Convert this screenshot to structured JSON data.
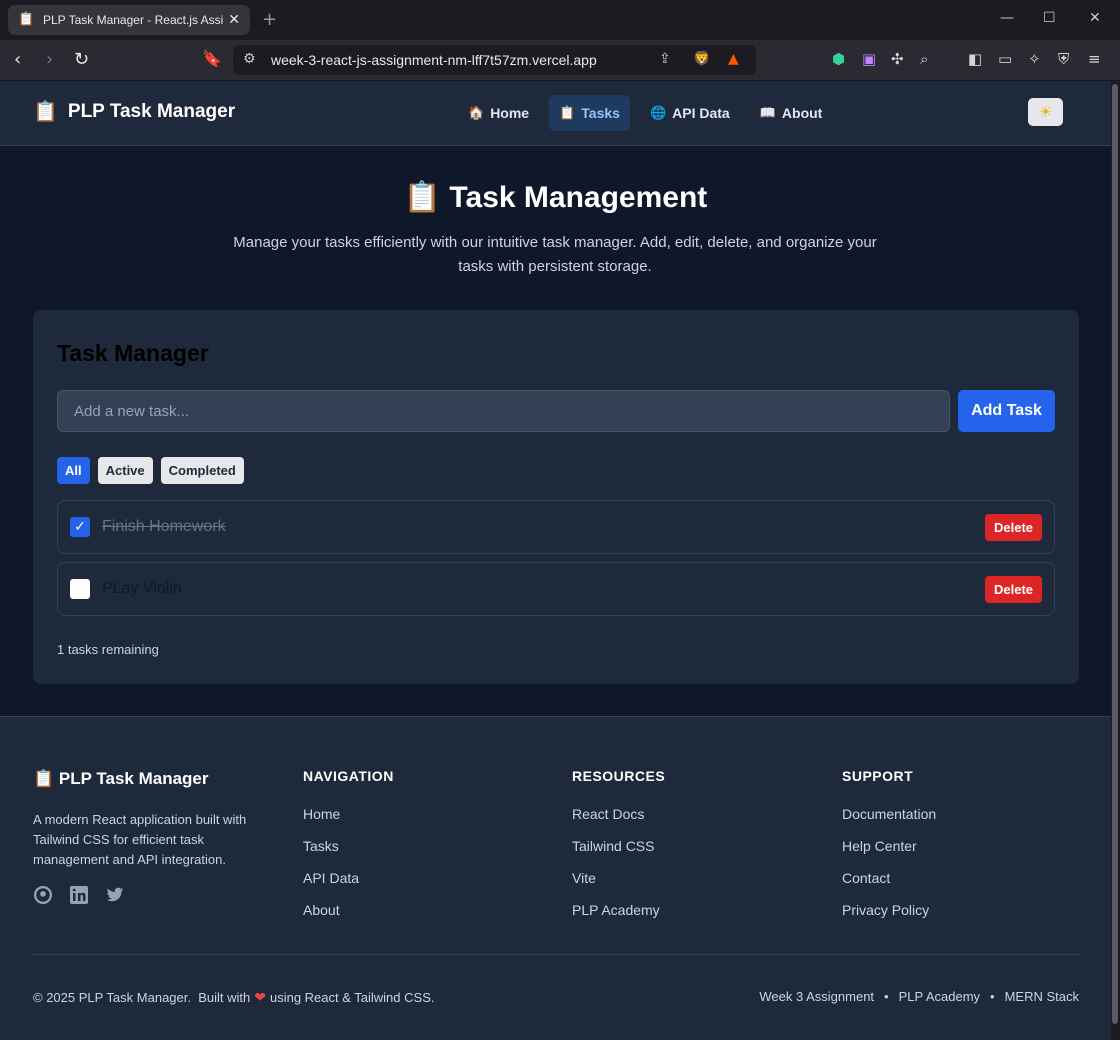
{
  "browser": {
    "tab_title": "PLP Task Manager - React.js Assig",
    "tab_favicon": "📋",
    "url": "week-3-react-js-assignment-nm-lff7t57zm.vercel.app",
    "brave_badge_count": "1"
  },
  "header": {
    "brand_icon": "📋",
    "brand": "PLP Task Manager",
    "nav": [
      {
        "icon": "🏠",
        "label": "Home",
        "active": false
      },
      {
        "icon": "📋",
        "label": "Tasks",
        "active": true
      },
      {
        "icon": "🌐",
        "label": "API Data",
        "active": false
      },
      {
        "icon": "📖",
        "label": "About",
        "active": false
      }
    ],
    "theme_icon": "☀"
  },
  "hero": {
    "icon": "📋",
    "title": "Task Management",
    "subtitle": "Manage your tasks efficiently with our intuitive task manager. Add, edit, delete, and organize your tasks with persistent storage."
  },
  "task_manager": {
    "title": "Task Manager",
    "input_placeholder": "Add a new task...",
    "input_value": "",
    "add_button": "Add Task",
    "filters": [
      {
        "label": "All",
        "active": true
      },
      {
        "label": "Active",
        "active": false
      },
      {
        "label": "Completed",
        "active": false
      }
    ],
    "tasks": [
      {
        "text": "Finish Homework",
        "completed": true,
        "delete_label": "Delete"
      },
      {
        "text": "PLay Violin",
        "completed": false,
        "delete_label": "Delete"
      }
    ],
    "remaining": "1 tasks remaining"
  },
  "footer": {
    "brand_icon": "📋",
    "brand": "PLP Task Manager",
    "description": "A modern React application built with Tailwind CSS for efficient task management and API integration.",
    "columns": [
      {
        "heading": "NAVIGATION",
        "links": [
          "Home",
          "Tasks",
          "API Data",
          "About"
        ]
      },
      {
        "heading": "RESOURCES",
        "links": [
          "React Docs",
          "Tailwind CSS",
          "Vite",
          "PLP Academy"
        ]
      },
      {
        "heading": "SUPPORT",
        "links": [
          "Documentation",
          "Help Center",
          "Contact",
          "Privacy Policy"
        ]
      }
    ],
    "copyright_before": "© 2025 PLP Task Manager.  Built with",
    "copyright_after": "using React & Tailwind CSS.",
    "meta": [
      "Week 3 Assignment",
      "PLP Academy",
      "MERN Stack"
    ]
  },
  "colors": {
    "accent": "#2563eb",
    "danger": "#dc2626",
    "surface": "#1e293b",
    "background": "#0f172a"
  }
}
